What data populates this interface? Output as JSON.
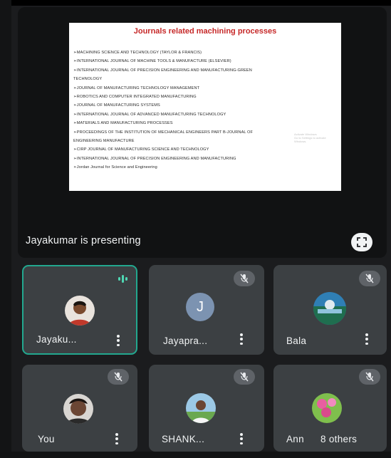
{
  "slide": {
    "title": "Journals related machining processes",
    "items": [
      "➢MACHINING SCIENCE AND TECHNOLOGY (TAYLOR & FRANCIS)",
      "➢INTERNATIONAL JOURNAL OF MACHINE TOOLS & MANUFACTURE (ELSEVIER)",
      "➢INTERNATIONAL JOURNAL OF PRECISION ENGINEERING AND MANUFACTURING-GREEN",
      "TECHNOLOGY",
      "➢JOURNAL OF MANUFACTURING TECHNOLOGY MANAGEMENT",
      "➢ROBOTICS AND COMPUTER INTEGRATED MANUFACTURING",
      "➢JOURNAL OF MANUFACTURING SYSTEMS",
      "➢INTERNATIONAL JOURNAL OF ADVANCED MANUFACTURING TECHNOLOGY",
      "➢MATERIALS AND MANUFACTURING PROCESSES",
      "➢PROCEEDINGS OF THE INSTITUTION OF MECHANICAL ENGINEERS PART B-JOURNAL OF",
      "ENGINEERING MANUFACTURE",
      "➢CIRP JOURNAL OF MANUFACTURING SCIENCE AND TECHNOLOGY",
      "➢INTERNATIONAL JOURNAL OF PRECISION ENGINEERING AND MANUFACTURING",
      "➢Jordan Journal for Science and Engineering"
    ],
    "watermark": [
      "Activate Windows",
      "Go to Settings to activate Windows."
    ]
  },
  "presenter_label": "Jayakumar is presenting",
  "icons": {
    "fullscreen": "fullscreen-icon",
    "muted": "mic-off-icon",
    "speaking": "audio-level-icon",
    "more": "more-vert-icon"
  },
  "colors": {
    "active_border": "#22a88f",
    "speaking": "#4fd7b3",
    "tile_bg": "#3c4043",
    "avatar_letter_bg": "#7c93b1"
  },
  "participants": [
    {
      "name": "Jayaku...",
      "muted": false,
      "speaking": true,
      "avatar": "photo"
    },
    {
      "name": "Jayapra...",
      "muted": true,
      "speaking": false,
      "avatar": "letter",
      "initial": "J"
    },
    {
      "name": "Bala",
      "muted": true,
      "speaking": false,
      "avatar": "photo"
    },
    {
      "name": "You",
      "muted": true,
      "speaking": false,
      "avatar": "photo"
    },
    {
      "name": "SHANK...",
      "muted": true,
      "speaking": false,
      "avatar": "photo"
    },
    {
      "name": "Ann",
      "muted": true,
      "speaking": false,
      "avatar": "photo"
    }
  ],
  "others_label": "8 others"
}
